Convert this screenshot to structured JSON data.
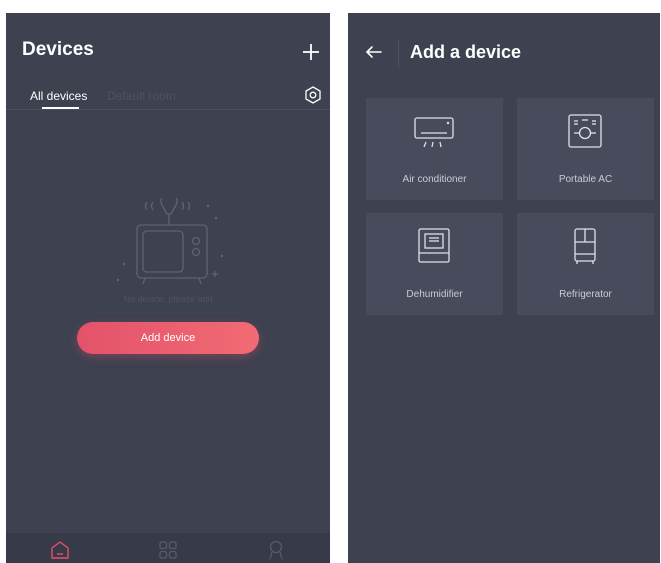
{
  "devices_screen": {
    "title": "Devices",
    "add_icon": "plus-icon",
    "tabs": [
      {
        "label": "All devices",
        "active": true
      },
      {
        "label": "Default room",
        "active": false
      }
    ],
    "settings_icon": "settings-icon",
    "empty_illustration": "tv-icon",
    "empty_text": "No device, please add",
    "add_button_label": "Add device",
    "bottom_nav": [
      {
        "icon": "home-icon",
        "active": true
      },
      {
        "icon": "grid-icon",
        "active": false
      },
      {
        "icon": "profile-icon",
        "active": false
      }
    ]
  },
  "add_device_screen": {
    "title": "Add a device",
    "back_icon": "back-arrow-icon",
    "devices": [
      {
        "label": "Air conditioner",
        "icon": "air-conditioner-icon"
      },
      {
        "label": "Portable AC",
        "icon": "portable-ac-icon"
      },
      {
        "label": "Dehumidifier",
        "icon": "dehumidifier-icon"
      },
      {
        "label": "Refrigerator",
        "icon": "refrigerator-icon"
      }
    ]
  },
  "colors": {
    "background": "#3d4150",
    "tile": "#474b5b",
    "accent": "#ef6172",
    "text": "#ffffff",
    "muted": "#4e5263"
  }
}
